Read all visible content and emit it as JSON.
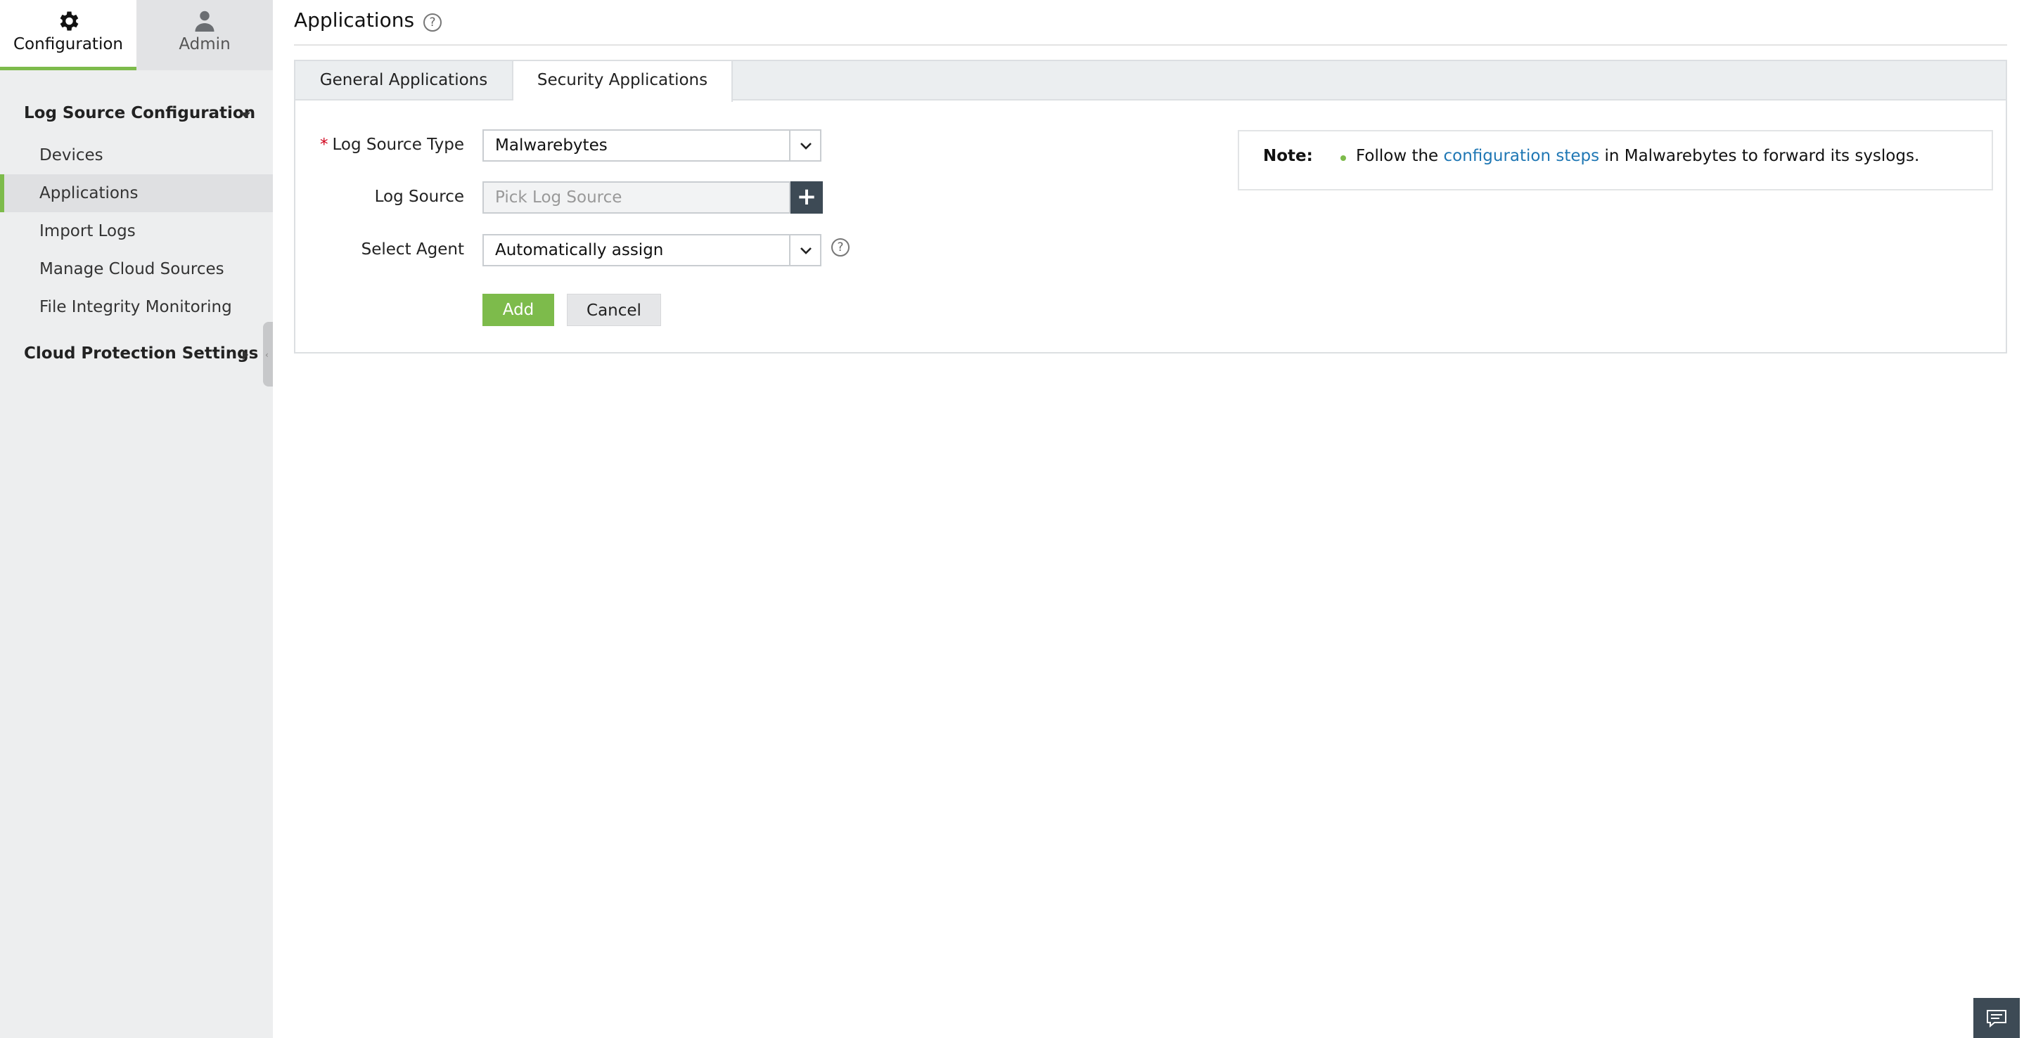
{
  "top_tabs": [
    {
      "label": "Configuration",
      "icon": "gear-icon"
    },
    {
      "label": "Admin",
      "icon": "user-icon"
    }
  ],
  "sidebar": {
    "section_log_source": "Log Source Configuration",
    "items": [
      "Devices",
      "Applications",
      "Import Logs",
      "Manage Cloud Sources",
      "File Integrity Monitoring"
    ],
    "active_item": "Applications",
    "section_cloud": "Cloud Protection Settings"
  },
  "page": {
    "title": "Applications",
    "help_glyph": "?"
  },
  "tabs": [
    {
      "label": "General Applications"
    },
    {
      "label": "Security Applications"
    }
  ],
  "form": {
    "required_mark": "*",
    "log_source_type_label": "Log Source Type",
    "log_source_type_value": "Malwarebytes",
    "log_source_label": "Log Source",
    "log_source_placeholder": "Pick Log Source",
    "plus_glyph": "+",
    "select_agent_label": "Select Agent",
    "select_agent_value": "Automatically assign",
    "add_label": "Add",
    "cancel_label": "Cancel"
  },
  "note": {
    "title": "Note:",
    "text_before": "Follow the ",
    "link_text": "configuration steps",
    "text_after": " in Malwarebytes to forward its syslogs."
  },
  "colors": {
    "accent_green": "#7dbb4b",
    "link_blue": "#1f77b4",
    "dark_button": "#3d4a55",
    "required_red": "#d0021b"
  }
}
